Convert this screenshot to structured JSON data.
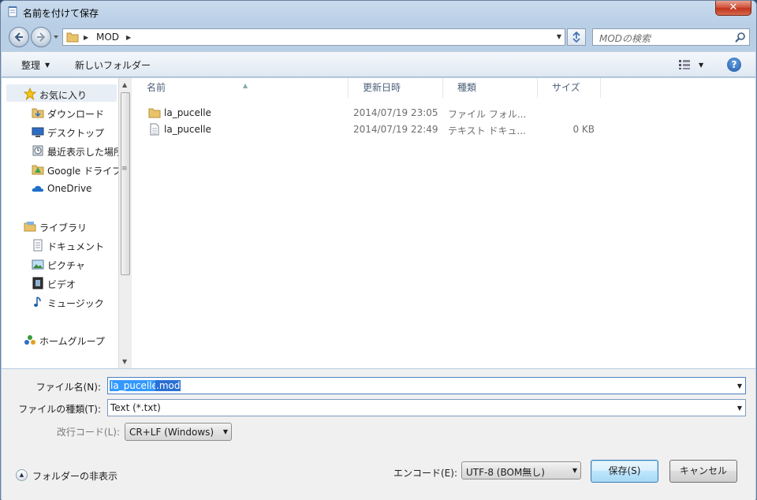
{
  "window": {
    "title": "名前を付けて保存"
  },
  "address": {
    "path_item": "MOD"
  },
  "search": {
    "placeholder": "MODの検索"
  },
  "toolbar": {
    "organize_label": "整理",
    "new_folder_label": "新しいフォルダー"
  },
  "nav": {
    "favorites": {
      "label": "お気に入り",
      "items": [
        "ダウンロード",
        "デスクトップ",
        "最近表示した場所",
        "Google ドライブ",
        "OneDrive"
      ]
    },
    "libraries": {
      "label": "ライブラリ",
      "items": [
        "ドキュメント",
        "ピクチャ",
        "ビデオ",
        "ミュージック"
      ]
    },
    "homegroup": {
      "label": "ホームグループ"
    }
  },
  "columns": [
    "名前",
    "更新日時",
    "種類",
    "サイズ"
  ],
  "files": [
    {
      "name": "la_pucelle",
      "date": "2014/07/19 23:05",
      "type": "ファイル フォル...",
      "size": "",
      "icon": "folder-icon"
    },
    {
      "name": "la_pucelle",
      "date": "2014/07/19 22:49",
      "type": "テキスト ドキュ...",
      "size": "0 KB",
      "icon": "text-file-icon"
    }
  ],
  "form": {
    "filename_label": "ファイル名(N):",
    "filename_selected": "la_pucelle",
    "filename_ext": ".mod",
    "filetype_label": "ファイルの種類(T):",
    "filetype_value": "Text (*.txt)",
    "linebreak_label": "改行コード(L):",
    "linebreak_value": "CR+LF (Windows)",
    "encoding_label": "エンコード(E):",
    "encoding_value": "UTF-8 (BOM無し)",
    "save_label": "保存(S)",
    "cancel_label": "キャンセル",
    "hide_folders_label": "フォルダーの非表示"
  },
  "colors": {
    "selection": "#3399ff",
    "window_frame": "#b9cfe6",
    "close_button": "#c7432a"
  }
}
